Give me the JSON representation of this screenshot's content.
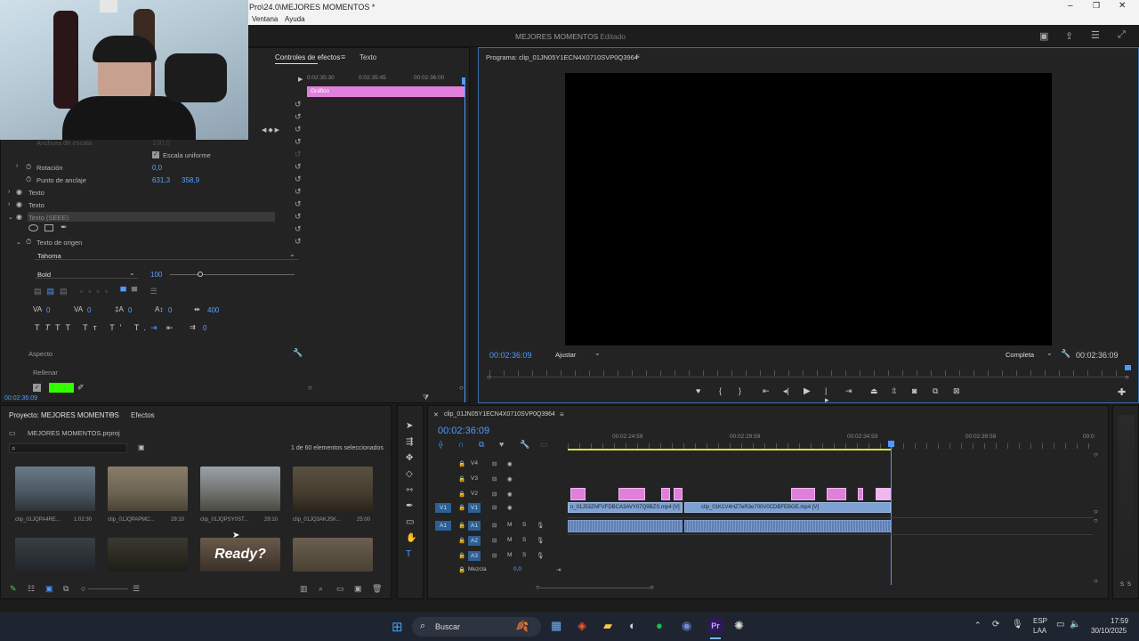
{
  "window": {
    "title": "Pro\\24.0\\MEJORES MOMENTOS *",
    "menu": [
      "Ventana",
      "Ayuda"
    ]
  },
  "app": {
    "project_title": "MEJORES MOMENTOS",
    "status": "- Editado"
  },
  "effect_controls": {
    "tabs": [
      "Controles de efectos",
      "Texto"
    ],
    "timecodes": [
      "0:02:35:30",
      "0:02:35:45",
      "00:02:36:00"
    ],
    "graphic_clip_label": "Gráfico",
    "width_label": "Anchura de escala",
    "width_value": "100,0",
    "uniform_scale_label": "Escala uniforme",
    "rotation_label": "Rotación",
    "rotation_value": "0,0",
    "anchor_label": "Punto de anclaje",
    "anchor_x": "631,3",
    "anchor_y": "358,9",
    "layers": [
      "Texto",
      "Texto",
      "Texto (SEEE)"
    ],
    "source_text_label": "Texto de origen",
    "font": "Tahoma",
    "font_style": "Bold",
    "font_size": "100",
    "kerning": "0",
    "tracking": "0",
    "leading": "0",
    "baseline": "0",
    "tsume": "400",
    "indent": "0",
    "aspect_label": "Aspecto",
    "fill_label": "Rellenar",
    "fill_color": "#33ff00",
    "bottom_timecode": "00:02:36:09"
  },
  "program_monitor": {
    "title": "Programa: clip_01JN05Y1ECN4X0710SVP0Q3964",
    "timecode_left": "00:02:36:09",
    "fit": "Ajustar",
    "resolution": "Completa",
    "timecode_right": "00:02:36:09"
  },
  "project_panel": {
    "tabs": [
      "Proyecto: MEJORES MOMENTOS",
      "Efectos"
    ],
    "file": "MEJORES MOMENTOS.prproj",
    "selection_status": "1 de 60 elementos seleccionados",
    "items": [
      {
        "name": "clip_01JQPA4RE...",
        "duration": "1:02:30"
      },
      {
        "name": "clip_01JQPAPMC...",
        "duration": "29:10"
      },
      {
        "name": "clip_01JQPSY0ST...",
        "duration": "29:10"
      },
      {
        "name": "clip_01JQ3AKJSK...",
        "duration": "25:00"
      },
      {
        "name": "",
        "duration": ""
      },
      {
        "name": "",
        "duration": ""
      },
      {
        "name": "",
        "duration": ""
      },
      {
        "name": "",
        "duration": ""
      }
    ],
    "ready_text": "Ready?"
  },
  "timeline": {
    "sequence_tab": "clip_01JN05Y1ECN4X0710SVP0Q3964",
    "timecode": "00:02:36:09",
    "ruler": [
      "00:02:24:59",
      "00:02:29:59",
      "00:02:34:59",
      "00:02:39:59",
      "00:0"
    ],
    "video_tracks": [
      "V4",
      "V3",
      "V2",
      "V1"
    ],
    "audio_tracks": [
      "A1",
      "A2",
      "A3"
    ],
    "v1_source": "V1",
    "a1_source": "A1",
    "mix_label": "Mezcla",
    "mix_value": "0,0",
    "clip1_label": "o_01J53ZNFVFDBCA3AVY07Q9BZS.mp4 [V]",
    "clip2_label": "clip_01K1V4HZ7eR3e700V0CDBFEBGE.mp4 [V]"
  },
  "taskbar": {
    "search": "Buscar",
    "lang": "ESP",
    "region": "LAA",
    "time": "17:59",
    "date": "30/10/2025"
  },
  "colors": {
    "accent": "#4d9bff",
    "graphic_clip": "#e07fdc",
    "video_clip": "#7da1d2",
    "audio_clip": "#5f7fb0",
    "timeline_bar": "#d8e040"
  },
  "audio_meter": {
    "labels": [
      "S",
      "S"
    ]
  }
}
